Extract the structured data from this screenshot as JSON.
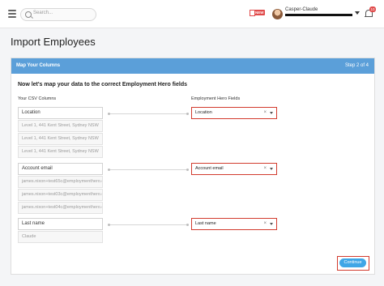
{
  "header": {
    "search_placeholder": "Search...",
    "new_badge": "NEW",
    "user_name": "Casper-Claude",
    "notification_count": "10"
  },
  "page": {
    "title": "Import Employees"
  },
  "wizard": {
    "step_title": "Map Your Columns",
    "step_counter": "Step 2 of 4",
    "intro": "Now let's map your data to the correct Employment Hero fields",
    "csv_columns_heading": "Your CSV Columns",
    "hero_fields_heading": "Employment Hero Fields"
  },
  "mappings": [
    {
      "csv_column": "Location",
      "samples": [
        "Level 1, 441 Kent Street, Sydney NSW",
        "Level 1, 441 Kent Street, Sydney NSW",
        "Level 1, 441 Kent Street, Sydney NSW"
      ],
      "hero_field": "Location"
    },
    {
      "csv_column": "Account email",
      "samples": [
        "james.nixon+test65c@employmenthero.com",
        "james.nixon+test03c@employmenthero.com",
        "james.nixon+test04c@employmenthero.com"
      ],
      "hero_field": "Account email"
    },
    {
      "csv_column": "Last name",
      "samples": [
        "Claude"
      ],
      "hero_field": "Last name"
    }
  ],
  "actions": {
    "continue_label": "Continue"
  },
  "colors": {
    "header_blue": "#5b9fd9",
    "highlight_red": "#d23b2e",
    "button_blue": "#3fa6e6"
  },
  "icons": [
    "menu-icon",
    "search-icon",
    "gift-icon",
    "avatar",
    "chevron-down-icon",
    "bell-icon",
    "clear-icon"
  ]
}
